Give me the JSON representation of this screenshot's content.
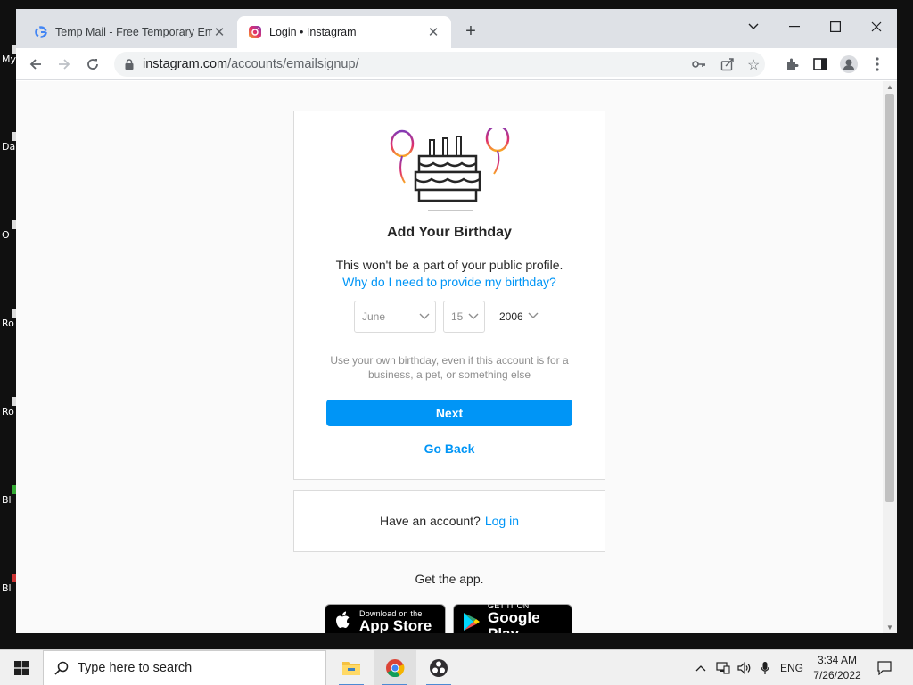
{
  "desktop": {
    "labels": [
      "My",
      "Da",
      "O",
      "Ro",
      "Ro",
      "Bl",
      "Bl"
    ]
  },
  "browser": {
    "tabs": [
      {
        "title": "Temp Mail - Free Temporary Ema",
        "icon": "google-icon",
        "active": false
      },
      {
        "title": "Login • Instagram",
        "icon": "instagram-icon",
        "active": true
      }
    ],
    "url_host": "instagram.com",
    "url_path": "/accounts/emailsignup/"
  },
  "page": {
    "heading": "Add Your Birthday",
    "subtext": "This won't be a part of your public profile.",
    "why_link": "Why do I need to provide my birthday?",
    "month": "June",
    "day": "15",
    "year": "2006",
    "note": "Use your own birthday, even if this account is for a business, a pet, or something else",
    "next_label": "Next",
    "go_back_label": "Go Back",
    "have_account": "Have an account?",
    "login_link": "Log in",
    "get_app": "Get the app.",
    "appstore_small": "Download on the",
    "appstore_big": "App Store",
    "googleplay_small": "GET IT ON",
    "googleplay_big": "Google Play",
    "accent_color": "#0095f6"
  },
  "taskbar": {
    "search_placeholder": "Type here to search",
    "language": "ENG",
    "time": "3:34 AM",
    "date": "7/26/2022"
  }
}
